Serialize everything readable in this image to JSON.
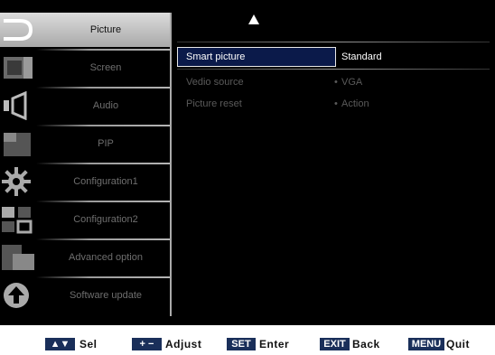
{
  "menu": {
    "items": [
      {
        "label": "Picture",
        "icon": "picture-icon",
        "selected": true
      },
      {
        "label": "Screen",
        "icon": "screen-icon",
        "selected": false
      },
      {
        "label": "Audio",
        "icon": "speaker-icon",
        "selected": false
      },
      {
        "label": "PIP",
        "icon": "pip-icon",
        "selected": false
      },
      {
        "label": "Configuration1",
        "icon": "gear-icon",
        "selected": false
      },
      {
        "label": "Configuration2",
        "icon": "grid-config-icon",
        "selected": false
      },
      {
        "label": "Advanced option",
        "icon": "advanced-icon",
        "selected": false
      },
      {
        "label": "Software update",
        "icon": "upload-icon",
        "selected": false
      }
    ]
  },
  "panel": {
    "rows": [
      {
        "label": "Smart picture",
        "value": "Standard",
        "highlighted": true
      },
      {
        "label": "Vedio source",
        "value": "VGA",
        "highlighted": false
      },
      {
        "label": "Picture reset",
        "value": "Action",
        "highlighted": false
      }
    ],
    "dot": "•"
  },
  "legend": {
    "sel_key": "▲▼",
    "sel_label": "Sel",
    "adjust_key": "+ −",
    "adjust_label": "Adjust",
    "set_key": "SET",
    "set_label": "Enter",
    "exit_key": "EXIT",
    "exit_label": "Back",
    "menu_key": "MENU",
    "menu_label": "Quit"
  },
  "colors": {
    "selected_row": "#0b1a4a",
    "key_bg": "#1a2f5a",
    "menu_selected": "#c8c8c8"
  }
}
